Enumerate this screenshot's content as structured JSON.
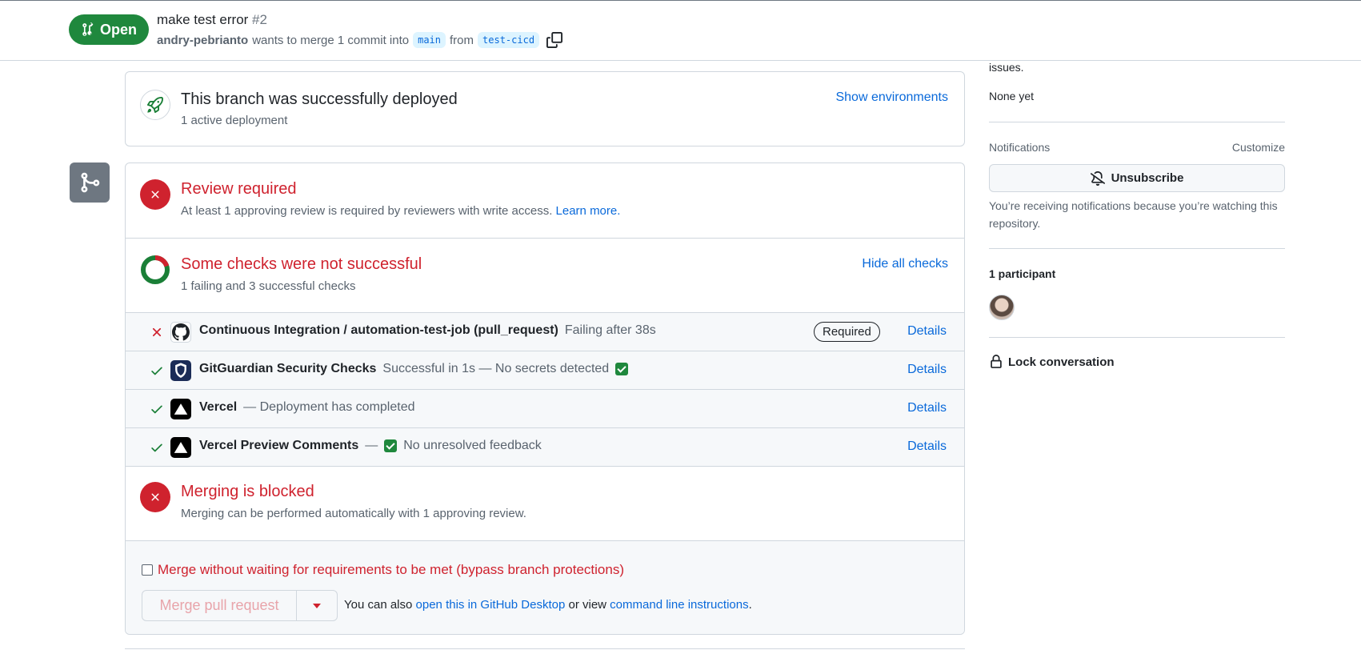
{
  "header": {
    "state": "Open",
    "title": "make test error",
    "number": "#2",
    "author": "andry-pebrianto",
    "meta_text": "wants to merge 1 commit into",
    "base_branch": "main",
    "from_text": "from",
    "head_branch": "test-cicd"
  },
  "deployment": {
    "title": "This branch was successfully deployed",
    "subtitle": "1 active deployment",
    "action": "Show environments"
  },
  "review": {
    "title": "Review required",
    "subtitle": "At least 1 approving review is required by reviewers with write access.",
    "link": "Learn more."
  },
  "checks_summary": {
    "title": "Some checks were not successful",
    "subtitle": "1 failing and 3 successful checks",
    "action": "Hide all checks"
  },
  "checks": [
    {
      "status": "failure",
      "name": "Continuous Integration / automation-test-job (pull_request)",
      "desc": "Failing after 38s",
      "badge": "Required",
      "details": "Details",
      "icon": "github-icon"
    },
    {
      "status": "success",
      "name": "GitGuardian Security Checks",
      "desc": "Successful in 1s — No secrets detected",
      "details": "Details",
      "icon": "gitguardian-icon"
    },
    {
      "status": "success",
      "name": "Vercel",
      "desc": "— Deployment has completed",
      "details": "Details",
      "icon": "vercel-icon"
    },
    {
      "status": "success",
      "name": "Vercel Preview Comments",
      "dash": "—",
      "desc": "No unresolved feedback",
      "details": "Details",
      "icon": "vercel-icon"
    }
  ],
  "blocked": {
    "title": "Merging is blocked",
    "subtitle": "Merging can be performed automatically with 1 approving review."
  },
  "bypass": {
    "label": "Merge without waiting for requirements to be met (bypass branch protections)",
    "checked": false
  },
  "merge": {
    "button": "Merge pull request",
    "alt_prefix": "You can also",
    "alt_link1": "open this in GitHub Desktop",
    "alt_mid": "or view",
    "alt_link2": "command line instructions",
    "alt_suffix": "."
  },
  "sidebar": {
    "issues_tail": "issues.",
    "issues_value": "None yet",
    "notifications_label": "Notifications",
    "customize": "Customize",
    "unsubscribe": "Unsubscribe",
    "notifications_note": "You’re receiving notifications because you’re watching this repository.",
    "participants": "1 participant",
    "lock": "Lock conversation"
  },
  "colors": {
    "open_green": "#1f883d",
    "danger_red": "#cf222e",
    "link_blue": "#0969da"
  }
}
